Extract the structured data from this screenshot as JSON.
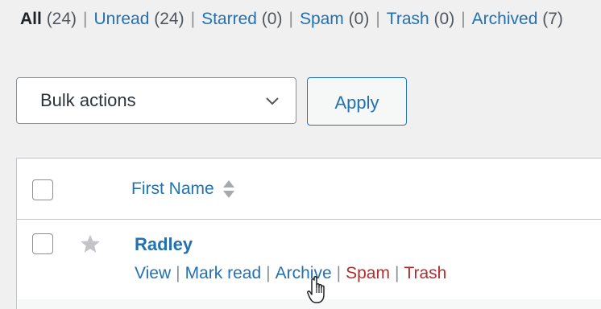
{
  "filters": [
    {
      "label": "All",
      "count": "(24)",
      "current": true
    },
    {
      "label": "Unread",
      "count": "(24)",
      "current": false
    },
    {
      "label": "Starred",
      "count": "(0)",
      "current": false
    },
    {
      "label": "Spam",
      "count": "(0)",
      "current": false
    },
    {
      "label": "Trash",
      "count": "(0)",
      "current": false
    },
    {
      "label": "Archived",
      "count": "(7)",
      "current": false
    }
  ],
  "separator": "|",
  "bulk": {
    "selected": "Bulk actions",
    "apply_label": "Apply"
  },
  "table": {
    "columns": {
      "first_name": "First Name"
    },
    "rows": [
      {
        "first_name": "Radley",
        "starred": false,
        "actions": {
          "view": "View",
          "mark_read": "Mark read",
          "archive": "Archive",
          "spam": "Spam",
          "trash": "Trash"
        }
      }
    ]
  },
  "colors": {
    "link": "#2271b1",
    "danger": "#b32d2e",
    "text": "#1d2327",
    "background": "#f0f0f1"
  },
  "icons": {
    "sort": "sort-icon",
    "star": "star-icon",
    "chevron": "chevron-down-icon",
    "cursor": "hand-pointer-icon"
  }
}
